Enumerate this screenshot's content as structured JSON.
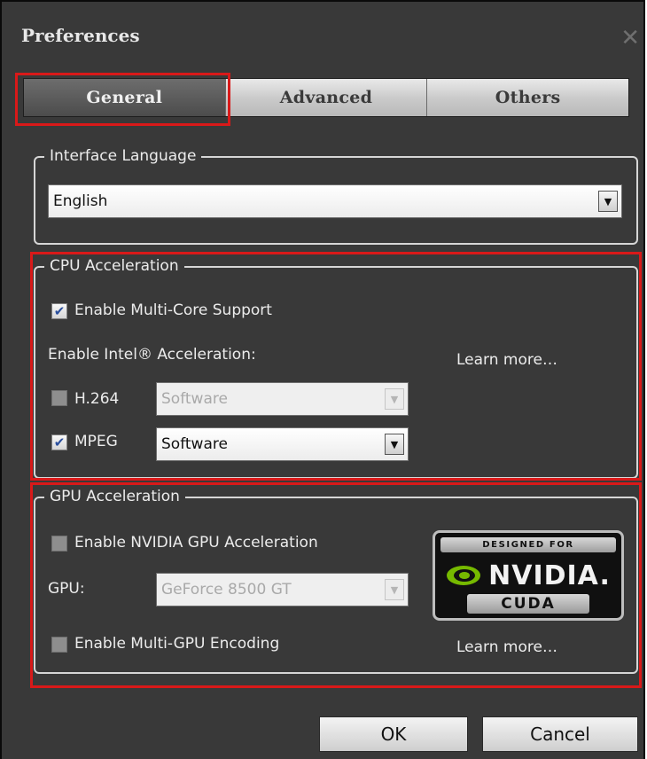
{
  "window": {
    "title": "Preferences",
    "close_glyph": "✕"
  },
  "tabs": [
    {
      "label": "General",
      "active": true
    },
    {
      "label": "Advanced",
      "active": false
    },
    {
      "label": "Others",
      "active": false
    }
  ],
  "interface_language": {
    "group_label": "Interface Language",
    "selected": "English"
  },
  "cpu_acceleration": {
    "group_label": "CPU Acceleration",
    "multicore": {
      "label": "Enable Multi-Core Support",
      "checked": true
    },
    "intel_label": "Enable Intel® Acceleration:",
    "learn_more": "Learn more…",
    "h264": {
      "label": "H.264",
      "checked": false,
      "mode": "Software",
      "enabled": false
    },
    "mpeg": {
      "label": "MPEG",
      "checked": true,
      "mode": "Software",
      "enabled": true
    }
  },
  "gpu_acceleration": {
    "group_label": "GPU Acceleration",
    "nvidia": {
      "label": "Enable NVIDIA GPU Acceleration",
      "checked": false
    },
    "gpu_label": "GPU:",
    "gpu_selected": "GeForce 8500 GT",
    "multigpu": {
      "label": "Enable Multi-GPU Encoding",
      "checked": false
    },
    "learn_more": "Learn more…",
    "badge": {
      "top": "DESIGNED FOR",
      "brand": "NVIDIA.",
      "bottom": "CUDA"
    }
  },
  "buttons": {
    "ok": "OK",
    "cancel": "Cancel"
  },
  "colors": {
    "background": "#393939",
    "highlight_red": "#d91919",
    "check_blue": "#2a4f9e",
    "nvidia_green": "#76b900"
  }
}
